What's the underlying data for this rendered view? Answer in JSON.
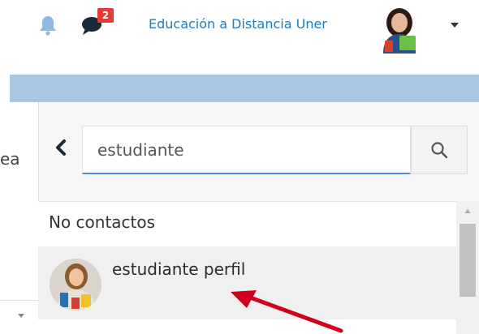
{
  "header": {
    "notifications_icon": "bell-icon",
    "messages_icon": "chat-icon",
    "messages_badge": "2",
    "user_name": "Educación a Distancia Uner",
    "user_menu_icon": "caret-down-icon"
  },
  "left_page": {
    "partial_text": "ea"
  },
  "messaging": {
    "back_icon": "chevron-left-icon",
    "search": {
      "value": "estudiante",
      "button_icon": "search-icon"
    },
    "results": {
      "no_contacts_label": "No contactos",
      "items": [
        {
          "name": "estudiante perfil"
        }
      ]
    }
  },
  "colors": {
    "link_blue": "#1f7bbf",
    "band_blue": "#a9c7e2",
    "badge_red": "#e53935",
    "annotation_red": "#d0021b"
  }
}
